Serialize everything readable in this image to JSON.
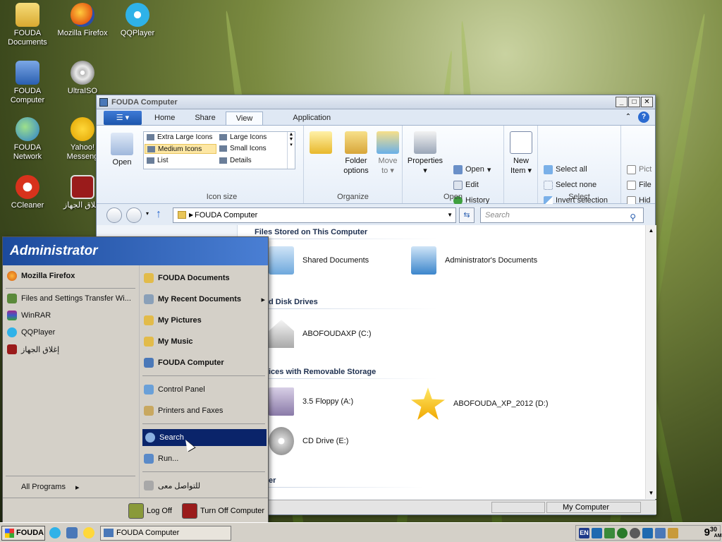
{
  "desktop": {
    "icons": [
      {
        "label": "FOUDA Documents",
        "icon": "folder-icon"
      },
      {
        "label": "Mozilla Firefox",
        "icon": "firefox-icon"
      },
      {
        "label": "QQPlayer",
        "icon": "qqplayer-icon"
      },
      {
        "label": "FOUDA Computer",
        "icon": "computer-icon"
      },
      {
        "label": "UltraISO",
        "icon": "disc-icon"
      },
      {
        "label": "FOUDA Network",
        "icon": "network-icon"
      },
      {
        "label": "Yahoo! Messeng",
        "icon": "yahoo-icon"
      },
      {
        "label": "CCleaner",
        "icon": "ccleaner-icon"
      },
      {
        "label": "إغلاق الجهاز",
        "icon": "power-icon"
      }
    ]
  },
  "window": {
    "title": "FOUDA Computer",
    "buttons": {
      "minimize": "_",
      "maximize": "□",
      "close": "✕"
    },
    "tabs": {
      "home": "Home",
      "share": "Share",
      "view": "View",
      "application": "Application"
    },
    "ribbon": {
      "open": "Open",
      "layout": {
        "extra_large": "Extra Large Icons",
        "large": "Large Icons",
        "medium": "Medium Icons",
        "small": "Small Icons",
        "list": "List",
        "details": "Details"
      },
      "icon_size_label": "Icon size",
      "folder_options": "Folder options",
      "folder_options_l1": "Folder",
      "folder_options_l2": "options",
      "move_to_l1": "Move",
      "move_to_l2": "to",
      "organize_label": "Organize",
      "properties": "Properties",
      "open_small": "Open",
      "edit": "Edit",
      "history": "History",
      "open_label": "Open",
      "new_item_l1": "New",
      "new_item_l2": "Item",
      "select_all": "Select all",
      "select_none": "Select none",
      "invert_selection": "Invert selection",
      "select_label": "Select",
      "pict": "Pict",
      "file": "File",
      "hid": "Hid"
    },
    "address": "FOUDA Computer",
    "search_placeholder": "Search",
    "sections": {
      "files": "Files Stored on This Computer",
      "hdd": "d Disk Drives",
      "removable": "ices with Removable Storage",
      "other": "er"
    },
    "items": {
      "shared_docs": "Shared Documents",
      "admin_docs": "Administrator's Documents",
      "c_drive": "ABOFOUDAXP (C:)",
      "floppy": "3.5 Floppy (A:)",
      "d_drive": "ABOFOUDA_XP_2012 (D:)",
      "cd_drive": "CD Drive (E:)"
    },
    "status": {
      "location": "My Computer"
    }
  },
  "start_menu": {
    "user": "Administrator",
    "pinned": "Mozilla Firefox",
    "recent": [
      "Files and Settings Transfer Wi...",
      "WinRAR",
      "QQPlayer",
      "إغلاق الجهاز"
    ],
    "all_programs": "All Programs",
    "right": {
      "documents": "FOUDA Documents",
      "recent_docs": "My Recent Documents",
      "pictures": "My Pictures",
      "music": "My Music",
      "computer": "FOUDA Computer",
      "control_panel": "Control Panel",
      "printers": "Printers and Faxes",
      "search": "Search",
      "run": "Run...",
      "contact": "للتواصل معى"
    },
    "log_off": "Log Off",
    "turn_off": "Turn Off Computer"
  },
  "taskbar": {
    "start": "FOUDA",
    "task": "FOUDA Computer",
    "lang": "EN",
    "clock_hour": "9",
    "clock_min": "30",
    "clock_ampm": "AM"
  }
}
